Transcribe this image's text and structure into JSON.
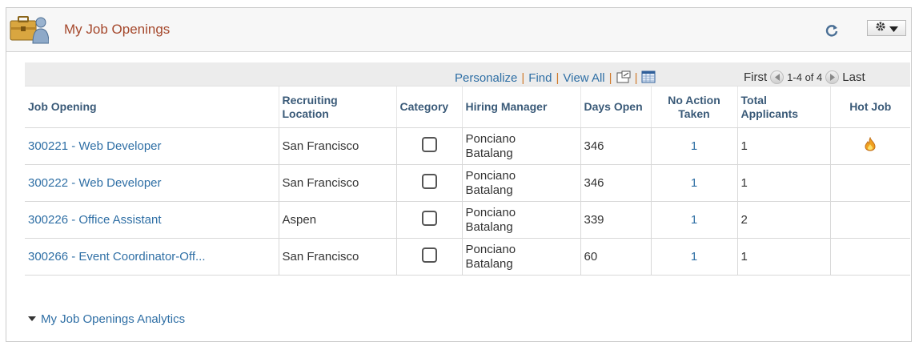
{
  "pagelet": {
    "title": "My Job Openings"
  },
  "toolbar": {
    "personalize": "Personalize",
    "find": "Find",
    "view_all": "View All",
    "separator": "|",
    "first": "First",
    "range": "1-4 of 4",
    "last": "Last"
  },
  "columns": {
    "job_opening": "Job Opening",
    "location_line1": "Recruiting",
    "location_line2": "Location",
    "category": "Category",
    "hiring_manager": "Hiring Manager",
    "days_open": "Days Open",
    "no_action_line1": "No Action",
    "no_action_line2": "Taken",
    "total_line1": "Total",
    "total_line2": "Applicants",
    "hot_job": "Hot Job"
  },
  "rows": [
    {
      "job": "300221 - Web Developer",
      "location": "San Francisco",
      "manager_first": "Ponciano",
      "manager_last": "Batalang",
      "days_open": "346",
      "no_action": "1",
      "total": "1",
      "hot": true
    },
    {
      "job": "300222 - Web Developer",
      "location": "San Francisco",
      "manager_first": "Ponciano",
      "manager_last": "Batalang",
      "days_open": "346",
      "no_action": "1",
      "total": "1",
      "hot": false
    },
    {
      "job": "300226 - Office Assistant",
      "location": "Aspen",
      "manager_first": "Ponciano",
      "manager_last": "Batalang",
      "days_open": "339",
      "no_action": "1",
      "total": "2",
      "hot": false
    },
    {
      "job": "300266 - Event Coordinator-Off...",
      "location": "San Francisco",
      "manager_first": "Ponciano",
      "manager_last": "Batalang",
      "days_open": "60",
      "no_action": "1",
      "total": "1",
      "hot": false
    }
  ],
  "analytics_label": "My Job Openings Analytics",
  "icons": {
    "pagelet": "briefcase-person-icon",
    "refresh": "refresh-icon",
    "gear": "gear-icon",
    "zoom": "new-window-icon",
    "download": "download-grid-icon",
    "prev": "prev-arrow-icon",
    "next": "next-arrow-icon",
    "hot": "flame-icon"
  },
  "colors": {
    "title": "#a5482c",
    "link": "#2f6fa5",
    "separator": "#d07a2c",
    "flame": "#f0a020"
  }
}
